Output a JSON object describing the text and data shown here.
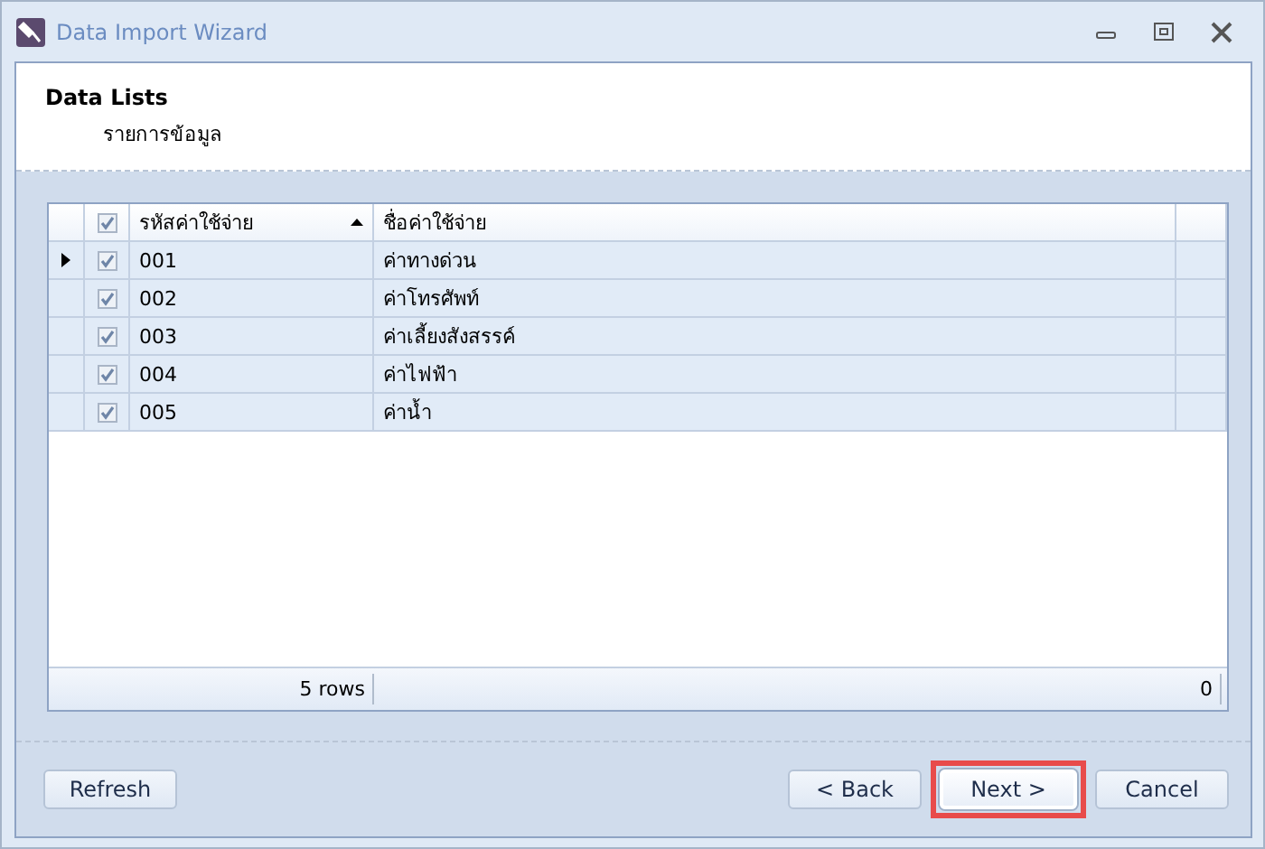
{
  "window": {
    "title": "Data Import Wizard"
  },
  "header": {
    "title": "Data Lists",
    "subtitle": "รายการข้อมูล"
  },
  "table": {
    "select_all": {
      "checked": true
    },
    "columns": [
      {
        "label": "รหัสค่าใช้จ่าย",
        "sorted": true
      },
      {
        "label": "ชื่อค่าใช้จ่าย",
        "sorted": false
      }
    ],
    "rows": [
      {
        "current": true,
        "checked": true,
        "code": "001",
        "name": "ค่าทางด่วน"
      },
      {
        "current": false,
        "checked": true,
        "code": "002",
        "name": "ค่าโทรศัพท์"
      },
      {
        "current": false,
        "checked": true,
        "code": "003",
        "name": "ค่าเลี้ยงสังสรรค์"
      },
      {
        "current": false,
        "checked": true,
        "code": "004",
        "name": "ค่าไฟฟ้า"
      },
      {
        "current": false,
        "checked": true,
        "code": "005",
        "name": "ค่าน้ำ"
      }
    ],
    "footer": {
      "count": "5 rows",
      "total": "0"
    }
  },
  "buttons": [
    {
      "kind": "left",
      "label": "Refresh",
      "highlighted": false
    },
    {
      "kind": "right",
      "label": "< Back",
      "highlighted": false
    },
    {
      "kind": "right",
      "label": "Next >",
      "highlighted": true
    },
    {
      "kind": "right",
      "label": "Cancel",
      "highlighted": false
    }
  ]
}
